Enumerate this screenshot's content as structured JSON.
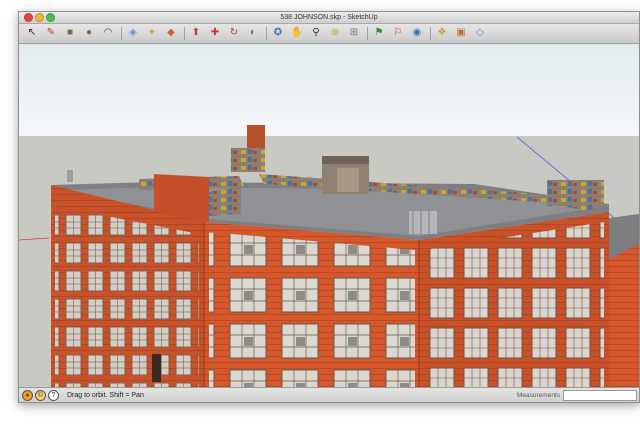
{
  "window": {
    "title": "538 JOHNSON.skp - SketchUp"
  },
  "toolbar": {
    "tools": [
      {
        "name": "select-tool-icon",
        "glyph": "↖",
        "color": "#222222"
      },
      {
        "name": "pencil-tool-icon",
        "glyph": "✎",
        "color": "#c0392b"
      },
      {
        "name": "rectangle-tool-icon",
        "glyph": "■",
        "color": "#8b6a3a"
      },
      {
        "name": "circle-tool-icon",
        "glyph": "●",
        "color": "#8b6a3a"
      },
      {
        "name": "arc-tool-icon",
        "glyph": "◠",
        "color": "#444444"
      },
      {
        "name": "eraser-tool-icon",
        "glyph": "◈",
        "color": "#5b8fd6"
      },
      {
        "name": "tape-measure-tool-icon",
        "glyph": "✦",
        "color": "#c9a227"
      },
      {
        "name": "paint-bucket-tool-icon",
        "glyph": "◆",
        "color": "#d1622b"
      },
      {
        "name": "push-pull-tool-icon",
        "glyph": "⬆",
        "color": "#c0392b"
      },
      {
        "name": "move-tool-icon",
        "glyph": "✚",
        "color": "#c0392b"
      },
      {
        "name": "rotate-tool-icon",
        "glyph": "↻",
        "color": "#c0392b"
      },
      {
        "name": "offset-tool-icon",
        "glyph": "◐",
        "color": "#6a6a6a"
      },
      {
        "name": "orbit-tool-icon",
        "glyph": "✪",
        "color": "#2e6fb5"
      },
      {
        "name": "pan-tool-icon",
        "glyph": "✋",
        "color": "#c8a36a"
      },
      {
        "name": "zoom-tool-icon",
        "glyph": "⚲",
        "color": "#333333"
      },
      {
        "name": "zoom-window-tool-icon",
        "glyph": "⊕",
        "color": "#c9a227"
      },
      {
        "name": "zoom-extents-tool-icon",
        "glyph": "⊞",
        "color": "#777777"
      },
      {
        "name": "get-models-icon",
        "glyph": "⚑",
        "color": "#2e8b3a"
      },
      {
        "name": "share-model-icon",
        "glyph": "⚐",
        "color": "#c0392b"
      },
      {
        "name": "google-earth-icon",
        "glyph": "◉",
        "color": "#2e6fb5"
      },
      {
        "name": "components-icon",
        "glyph": "❖",
        "color": "#c9a227"
      },
      {
        "name": "materials-icon",
        "glyph": "▣",
        "color": "#c46a2b"
      },
      {
        "name": "styles-icon",
        "glyph": "◇",
        "color": "#5b8fd6"
      }
    ]
  },
  "statusbar": {
    "icons": [
      {
        "name": "geo-location-icon",
        "glyph": "●"
      },
      {
        "name": "credits-icon",
        "glyph": "©"
      },
      {
        "name": "help-icon",
        "glyph": "?"
      }
    ],
    "hint": "Drag to orbit.  Shift = Pan",
    "measurements_label": "Measurements",
    "measurements_value": ""
  }
}
